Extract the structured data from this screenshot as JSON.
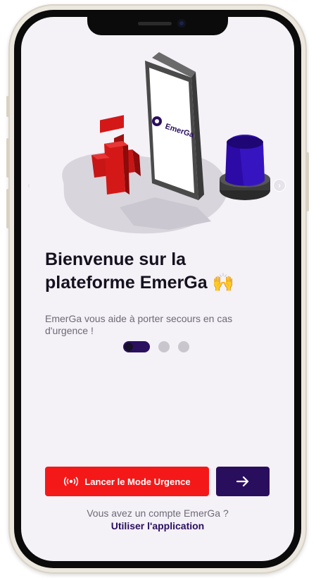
{
  "onboarding": {
    "title_line1": "Bienvenue sur la",
    "title_line2": "plateforme EmerGa",
    "title_emoji": "🙌",
    "subtitle": "EmerGa vous aide à porter secours en cas d'urgence !",
    "illustration_logo_text": "EmerGa",
    "pagination": {
      "total": 3,
      "active": 1
    }
  },
  "actions": {
    "emergency_label": "Lancer le Mode Urgence",
    "emergency_icon": "broadcast-icon",
    "next_icon": "arrow-right-icon"
  },
  "account": {
    "question": "Vous avez un compte EmerGa ?",
    "link": "Utiliser l'application"
  },
  "colors": {
    "background": "#f4f1f7",
    "primary": "#2a0e5e",
    "danger": "#f51818",
    "text": "#15121f",
    "muted": "#6e6a76"
  }
}
